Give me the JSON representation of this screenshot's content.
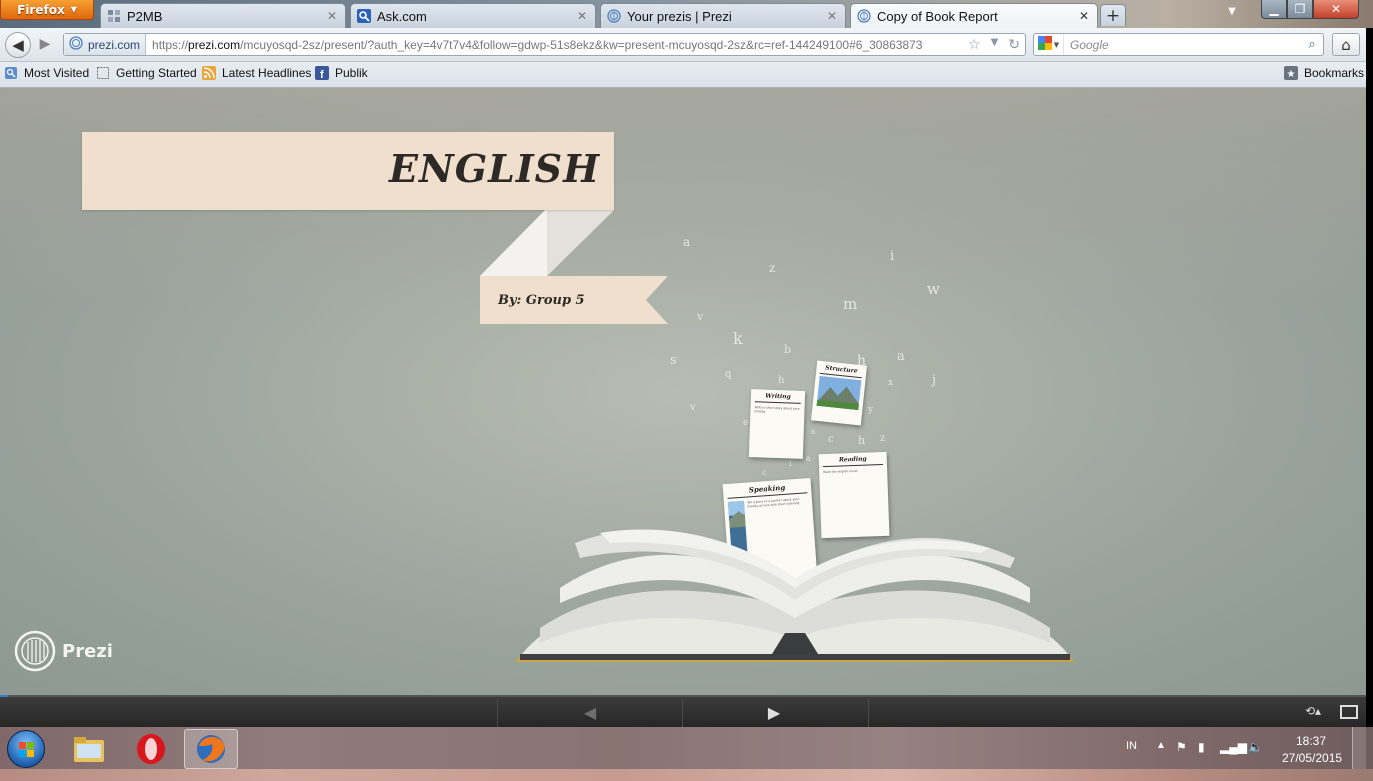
{
  "browser": {
    "app_button": "Firefox",
    "tabs": [
      {
        "title": "P2MB",
        "icon": "p2mb-favicon"
      },
      {
        "title": "Ask.com",
        "icon": "search-favicon"
      },
      {
        "title": "Your prezis | Prezi",
        "icon": "prezi-favicon"
      },
      {
        "title": "Copy of Book Report",
        "icon": "prezi-favicon",
        "active": true
      }
    ],
    "new_tab": "+",
    "site_identity": "prezi.com",
    "url_prefix": "https://",
    "url_host": "prezi.com",
    "url_path": "/mcuyosqd-2sz/present/?auth_key=4v7t7v4&follow=gdwp-51s8ekz&kw=present-mcuyosqd-2sz&rc=ref-144249100#6_30863873",
    "search_placeholder": "Google",
    "bookmarks": [
      {
        "label": "Most Visited",
        "icon": "most-visited-icon"
      },
      {
        "label": "Getting Started",
        "icon": "page-icon"
      },
      {
        "label": "Latest Headlines",
        "icon": "rss-icon"
      },
      {
        "label": "Publik",
        "icon": "facebook-icon"
      }
    ],
    "bookmarks_menu": "Bookmarks"
  },
  "presentation": {
    "title": "ENGLISH",
    "subtitle": "By: Group 5",
    "cards": {
      "writing": {
        "title": "Writing",
        "text": "Write a short story about your holiday"
      },
      "picture_top": {
        "title": "Structure"
      },
      "reading": {
        "title": "Reading",
        "text": "Read the english novel"
      },
      "speaking": {
        "title": "Speaking",
        "text": "Tell a story to a partner about your holiday picture with short listening"
      }
    },
    "letters": [
      "a",
      "z",
      "i",
      "w",
      "m",
      "v",
      "k",
      "b",
      "s",
      "h",
      "a",
      "j",
      "q",
      "h",
      "x",
      "y",
      "v",
      "e",
      "c",
      "h",
      "z",
      "s",
      "a",
      "c",
      "i"
    ],
    "logo": "Prezi"
  },
  "taskbar": {
    "language": "IN",
    "time": "18:37",
    "date": "27/05/2015"
  },
  "colors": {
    "banner": "#efdfcc",
    "title_text": "#2d2926",
    "firefox_orange": "#e8761a",
    "stage_bg": "#a9b0a7"
  }
}
